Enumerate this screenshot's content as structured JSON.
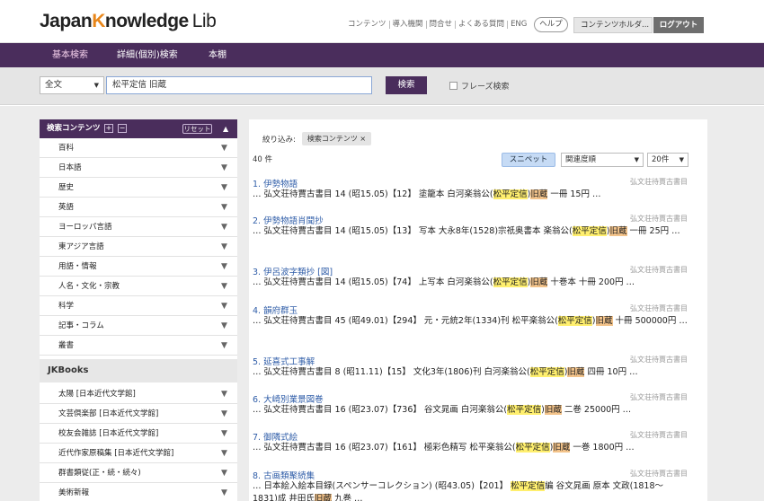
{
  "header": {
    "logo": {
      "part1": "Japan",
      "part2": "K",
      "part3": "nowledge",
      "part4": "Lib"
    },
    "links": [
      "コンテンツ",
      "導入機関",
      "問合せ",
      "よくある質問",
      "ENG"
    ],
    "help": "ヘルプ",
    "holder": "コンテンツホルダ...",
    "logout": "ログアウト"
  },
  "nav": {
    "tabs": [
      "基本検索",
      "詳細(個別)検索",
      "本棚"
    ]
  },
  "search": {
    "scope": "全文",
    "query": "松平定信 旧蔵",
    "button": "検索",
    "phrase": "フレーズ検索"
  },
  "sidebar": {
    "title": "検索コンテンツ",
    "plus": "+",
    "minus": "−",
    "reset": "リセット",
    "items": [
      "百科",
      "日本語",
      "歴史",
      "英語",
      "ヨーロッパ言語",
      "東アジア言語",
      "用語・情報",
      "人名・文化・宗教",
      "科学",
      "記事・コラム",
      "叢書"
    ],
    "section": "JKBooks",
    "books": [
      "太陽 [日本近代文学館]",
      "文芸倶楽部 [日本近代文学館]",
      "校友会雑誌 [日本近代文学館]",
      "近代作家原稿集 [日本近代文学館]",
      "群書類従(正・続・続々)",
      "美術新報"
    ]
  },
  "results": {
    "filter_label": "絞り込み:",
    "filter_chip": "検索コンテンツ ×",
    "count": "40 件",
    "snippet": "スニペット",
    "sort": "関連度順",
    "per_page": "20件",
    "items": [
      {
        "num": "1.",
        "title": "伊勢物語",
        "source": "弘文荘待賈古書目",
        "pre": "… 弘文荘待賈古書目 14 (昭15.05)【12】 塗籠本 白河楽翁公(",
        "hl": "松平定信",
        "mid": ")",
        "hl2": "旧蔵",
        "post": " 一冊 15円 …"
      },
      {
        "num": "2.",
        "title": "伊勢物語肖聞抄",
        "source": "弘文荘待賈古書目",
        "pre": "… 弘文荘待賈古書目 14 (昭15.05)【13】 写本 大永8年(1528)宗祇奥書本 楽翁公(",
        "hl": "松平定信",
        "mid": ")",
        "hl2": "旧蔵",
        "post": " 一冊 25円 …"
      },
      {
        "num": "3.",
        "title": "伊呂波字類抄 [図]",
        "source": "弘文荘待賈古書目",
        "pre": "… 弘文荘待賈古書目 14 (昭15.05)【74】 上写本 白河楽翁公(",
        "hl": "松平定信",
        "mid": ")",
        "hl2": "旧蔵",
        "post": " 十巻本 十冊 200円 …"
      },
      {
        "num": "4.",
        "title": "韻府群玉",
        "source": "弘文荘待賈古書目",
        "pre": "… 弘文荘待賈古書目 45 (昭49.01)【294】 元・元統2年(1334)刊 松平楽翁公(",
        "hl": "松平定信",
        "mid": ")",
        "hl2": "旧蔵",
        "post": " 十冊 500000円 …"
      },
      {
        "num": "5.",
        "title": "延喜式工事解",
        "source": "弘文荘待賈古書目",
        "pre": "… 弘文荘待賈古書目 8 (昭11.11)【15】 文化3年(1806)刊 白河楽翁公(",
        "hl": "松平定信",
        "mid": ")",
        "hl2": "旧蔵",
        "post": " 四冊 10円 …"
      },
      {
        "num": "6.",
        "title": "大崎別業景図巻",
        "source": "弘文荘待賈古書目",
        "pre": "… 弘文荘待賈古書目 16 (昭23.07)【736】 谷文晁画 白河楽翁公(",
        "hl": "松平定信",
        "mid": ")",
        "hl2": "旧蔵",
        "post": " 二巻 25000円 …"
      },
      {
        "num": "7.",
        "title": "御隣式絵",
        "source": "弘文荘待賈古書目",
        "pre": "… 弘文荘待賈古書目 16 (昭23.07)【161】 極彩色精写 松平楽翁公(",
        "hl": "松平定信",
        "mid": ")",
        "hl2": "旧蔵",
        "post": " 一巻 1800円 …"
      },
      {
        "num": "8.",
        "title": "古画類聚続集",
        "source": "弘文荘待賈古書目",
        "pre": "… 日本絵入絵本目録(スペンサーコレクション) (昭43.05)【201】 ",
        "hl": "松平定信",
        "mid": "編 谷文晁画 原本 文政(1818〜1831)成 井田氏",
        "hl2": "旧蔵",
        "post": " 九巻 …"
      }
    ]
  }
}
